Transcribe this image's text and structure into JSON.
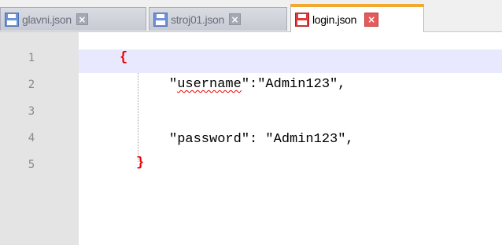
{
  "tabs": [
    {
      "label": "glavni.json",
      "state": "saved",
      "close_icon": "close-icon"
    },
    {
      "label": "stroj01.json",
      "state": "saved",
      "close_icon": "close-icon"
    },
    {
      "label": "login.json",
      "state": "unsaved",
      "active": true,
      "close_icon": "close-icon"
    }
  ],
  "editor": {
    "current_line": 1,
    "line_numbers": [
      "1",
      "2",
      "3",
      "4",
      "5"
    ],
    "lines": {
      "open_brace": "{",
      "username_q1": "\"",
      "username_key": "username",
      "username_rest": "\":\"Admin123\",",
      "password": "\"password\": \"Admin123\",",
      "close_brace": "}"
    }
  },
  "colors": {
    "active_tab_accent": "#f3a830",
    "brace": "#ee0000",
    "spellcheck_underline": "#ee0000",
    "current_line_highlight": "#e8e8ff",
    "gutter": "#e4e4e4"
  }
}
